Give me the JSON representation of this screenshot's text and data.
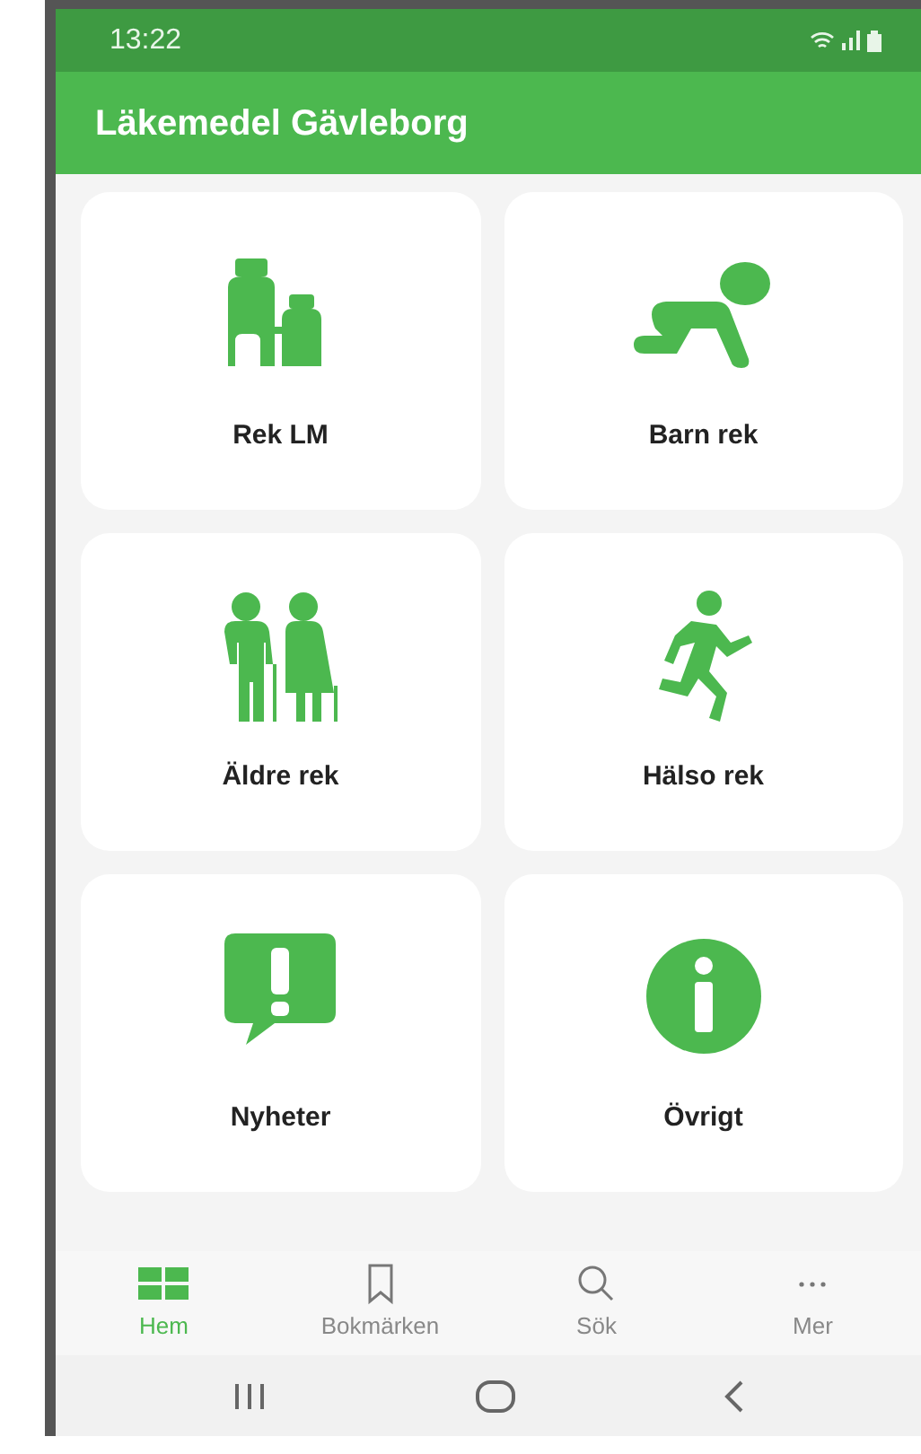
{
  "status_bar": {
    "time": "13:22"
  },
  "app_bar": {
    "title": "Läkemedel Gävleborg"
  },
  "tiles": [
    {
      "label": "Rek LM"
    },
    {
      "label": "Barn rek"
    },
    {
      "label": "Äldre rek"
    },
    {
      "label": "Hälso rek"
    },
    {
      "label": "Nyheter"
    },
    {
      "label": "Övrigt"
    }
  ],
  "bottom_nav": [
    {
      "label": "Hem",
      "selected": true
    },
    {
      "label": "Bokmärken",
      "selected": false
    },
    {
      "label": "Sök",
      "selected": false
    },
    {
      "label": "Mer",
      "selected": false
    }
  ]
}
